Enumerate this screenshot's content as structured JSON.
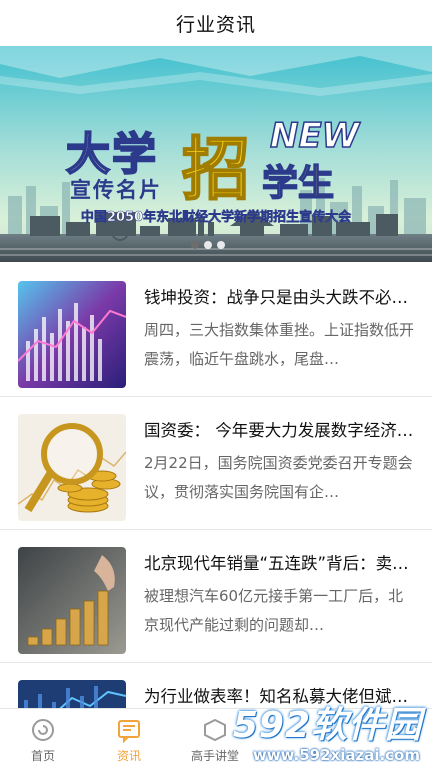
{
  "header": {
    "title": "行业资讯"
  },
  "banner": {
    "line_big": "大学",
    "line_small": "宣传名片",
    "zhao": "招",
    "new": "NEW",
    "students": "学生",
    "subtitle": "中国2050年东北财经大学新学期招生宣传大会",
    "dots": 3,
    "active_dot": 0
  },
  "articles": [
    {
      "title": "钱坤投资：战争只是由头大跌不必惊慌",
      "desc": "周四，三大指数集体重挫。上证指数低开震荡，临近午盘跳水，尾盘…",
      "thumb": "stock-chart-purple"
    },
    {
      "title": "国资委： 今年要大力发展数字经济…",
      "desc": "2月22日，国务院国资委党委召开专题会议，贯彻落实国务院国有企…",
      "thumb": "gold-coins-magnifier"
    },
    {
      "title": "北京现代年销量“五连跌”背后：卖…",
      "desc": "被理想汽车60亿元接手第一工厂后，北京现代产能过剩的问题却…",
      "thumb": "coin-stacks"
    },
    {
      "title": "为行业做表率！知名私募大佬但斌…",
      "desc": "",
      "thumb": "stock-chart-blue"
    }
  ],
  "tabbar": [
    {
      "label": "首页",
      "icon": "home-icon",
      "active": false
    },
    {
      "label": "资讯",
      "icon": "news-icon",
      "active": true
    },
    {
      "label": "高手讲堂",
      "icon": "lecture-icon",
      "active": false
    },
    {
      "label": "",
      "icon": "",
      "active": false
    },
    {
      "label": "",
      "icon": "",
      "active": false
    }
  ],
  "watermark": {
    "main": "592软件园",
    "url": "www.592xiazai.com"
  },
  "colors": {
    "accent": "#f3a33b",
    "inactive": "#666666"
  }
}
